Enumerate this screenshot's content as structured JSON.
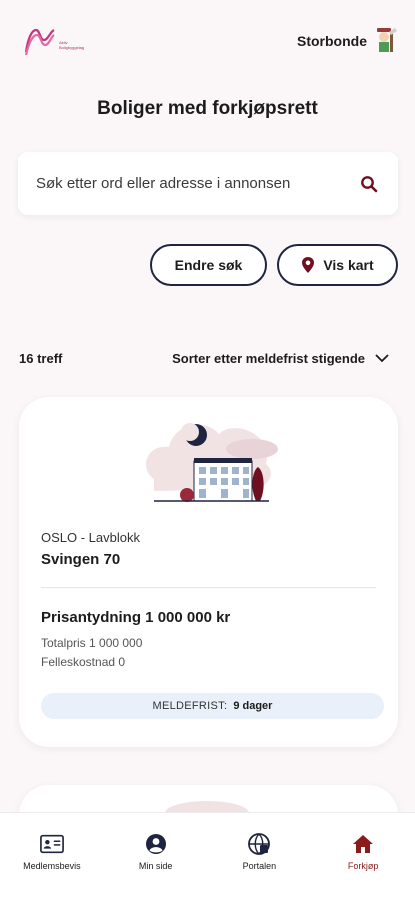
{
  "header": {
    "logo_text_line1": "Aktiv",
    "logo_text_line2": "Boligbyggelag",
    "user_name": "Storbonde"
  },
  "page_title": "Boliger med forkjøpsrett",
  "search": {
    "placeholder": "Søk etter ord eller adresse i annonsen"
  },
  "actions": {
    "edit_search": "Endre søk",
    "show_map": "Vis kart"
  },
  "results": {
    "count_label": "16 treff",
    "sort_label": "Sorter etter meldefrist stigende"
  },
  "listing": {
    "location": "OSLO - Lavblokk",
    "address": "Svingen 70",
    "price": "Prisantydning 1 000 000 kr",
    "total": "Totalpris 1 000 000",
    "common_cost": "Felleskostnad 0",
    "deadline_label": "MELDEFRIST:",
    "deadline_value": "9 dager"
  },
  "nav": [
    {
      "label": "Medlemsbevis",
      "icon": "member-card-icon"
    },
    {
      "label": "Min side",
      "icon": "user-circle-icon"
    },
    {
      "label": "Portalen",
      "icon": "portal-icon"
    },
    {
      "label": "Forkjøp",
      "icon": "home-icon",
      "active": true
    }
  ],
  "colors": {
    "accent": "#6e1020",
    "brand": "#c2357a",
    "navy": "#1f2440",
    "deadline_bg": "#e9f0fa"
  }
}
